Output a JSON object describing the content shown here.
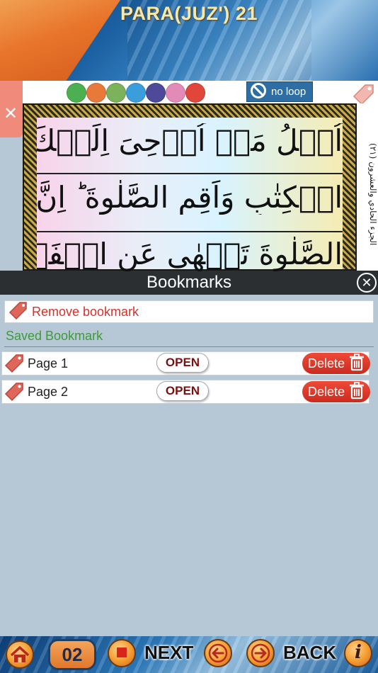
{
  "header": {
    "title": "PARA(JUZ') 21"
  },
  "controls": {
    "swatches": [
      "#4caf50",
      "#e8793a",
      "#7cb25a",
      "#3a9ddc",
      "#4d4a9a",
      "#e38ab8",
      "#e0473a"
    ],
    "loop_label": "no loop"
  },
  "quran": {
    "line1": "اُتۡلُ مَاۤ اُوۡحِیَ اِلَیۡكَ مِنَ",
    "line2": "الۡكِتٰبِ وَاَقِمِ الصَّلٰوةَ ؕ اِنَّ",
    "line3": "الصَّلٰوةَ تَنۡهٰی عَنِ الۡفَحۡشَآءِ",
    "side_note": "الجزء الحادي والعشرون (٢١)"
  },
  "bookmarks_bar": {
    "title": "Bookmarks"
  },
  "panel": {
    "remove_label": "Remove bookmark",
    "saved_label": "Saved Bookmark",
    "items": [
      {
        "label": "Page 1",
        "open_label": "OPEN",
        "delete_label": "Delete"
      },
      {
        "label": "Page 2",
        "open_label": "OPEN",
        "delete_label": "Delete"
      }
    ]
  },
  "bottom_bar": {
    "page_number": "02",
    "next_label": "NEXT",
    "back_label": "BACK"
  }
}
